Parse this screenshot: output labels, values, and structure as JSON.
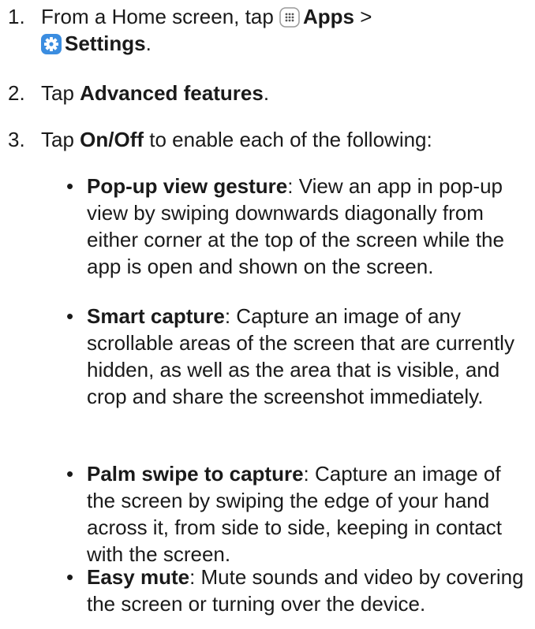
{
  "steps": [
    {
      "number": "1.",
      "prefix": "From a Home screen, tap",
      "apps_label": "Apps",
      "separator": ">",
      "settings_label": "Settings",
      "suffix": "."
    },
    {
      "number": "2.",
      "prefix": "Tap",
      "bold": "Advanced features",
      "suffix": "."
    },
    {
      "number": "3.",
      "prefix": "Tap",
      "bold": "On/Off",
      "suffix": "to enable each of the following:"
    }
  ],
  "features": [
    {
      "title": "Pop-up view gesture",
      "description": ": View an app in pop-up view by swiping downwards diagonally from either corner at the top of the screen while the app is open and shown on the screen."
    },
    {
      "title": "Smart capture",
      "description": ": Capture an image of any scrollable areas of the screen that are currently hidden, as well as the area that is visible, and crop and share the screenshot immediately."
    },
    {
      "title": "Palm swipe to capture",
      "description": ": Capture an image of the screen by swiping the edge of your hand across it, from side to side, keeping in contact with the screen."
    },
    {
      "title": "Easy mute",
      "description": ": Mute sounds and video by covering the screen or turning over the device."
    }
  ],
  "icons": {
    "apps": "apps-grid-icon",
    "settings": "settings-gear-icon"
  },
  "colors": {
    "text": "#1a1a1a",
    "settings_icon_bg": "#3b8de0",
    "apps_icon_border": "#9a9a9a"
  }
}
